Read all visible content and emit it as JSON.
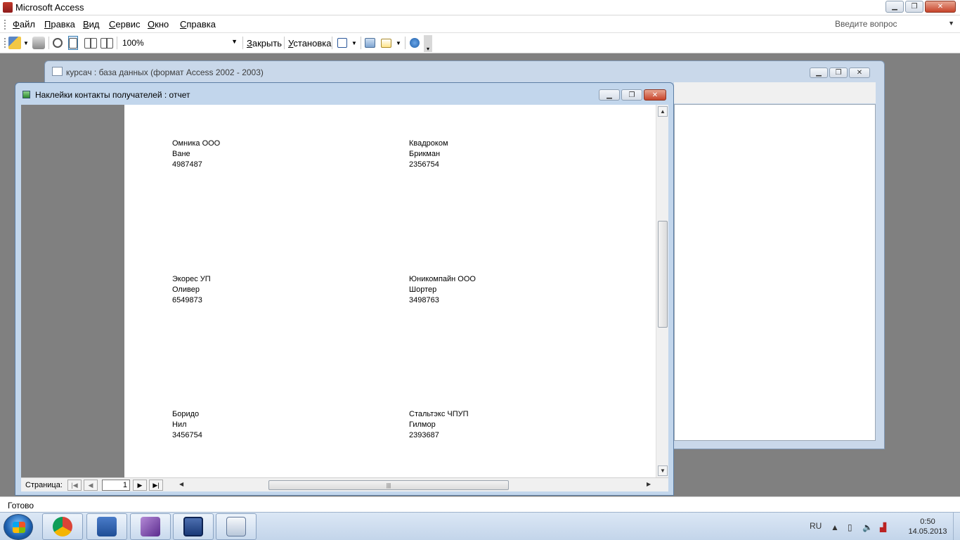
{
  "app": {
    "title": "Microsoft Access"
  },
  "menu": {
    "items": [
      "Файл",
      "Правка",
      "Вид",
      "Сервис",
      "Окно",
      "Справка"
    ],
    "ask_placeholder": "Введите вопрос"
  },
  "toolbar": {
    "zoom_value": "100%",
    "close_label": "Закрыть",
    "setup_label": "Установка"
  },
  "db_window": {
    "title": "курсач : база данных (формат Access 2002 - 2003)"
  },
  "report_window": {
    "title": "Наклейки контакты получателей : отчет",
    "labels": [
      {
        "company": "Омника ООО",
        "name": "Ване",
        "phone": "4987487"
      },
      {
        "company": "Квадроком",
        "name": "Брикман",
        "phone": "2356754"
      },
      {
        "company": "Экорес УП",
        "name": "Оливер",
        "phone": "6549873"
      },
      {
        "company": "Юникомпайн ООО",
        "name": "Шортер",
        "phone": "3498763"
      },
      {
        "company": "Боридо",
        "name": "Нил",
        "phone": "3456754"
      },
      {
        "company": "Стальтэкс ЧПУП",
        "name": "Гилмор",
        "phone": "2393687"
      }
    ],
    "nav": {
      "page_label": "Страница:",
      "page_number": "1"
    }
  },
  "status": {
    "text": "Готово"
  },
  "taskbar": {
    "apps": [
      "chrome-icon",
      "word-icon",
      "visual-studio-icon",
      "save-icon",
      "window-icon"
    ],
    "lang": "RU",
    "time": "0:50",
    "date": "14.05.2013"
  },
  "colors": {
    "titlebar_active": "#c2d6ec",
    "close_red": "#c7442a",
    "mdi_bg": "#808080"
  }
}
